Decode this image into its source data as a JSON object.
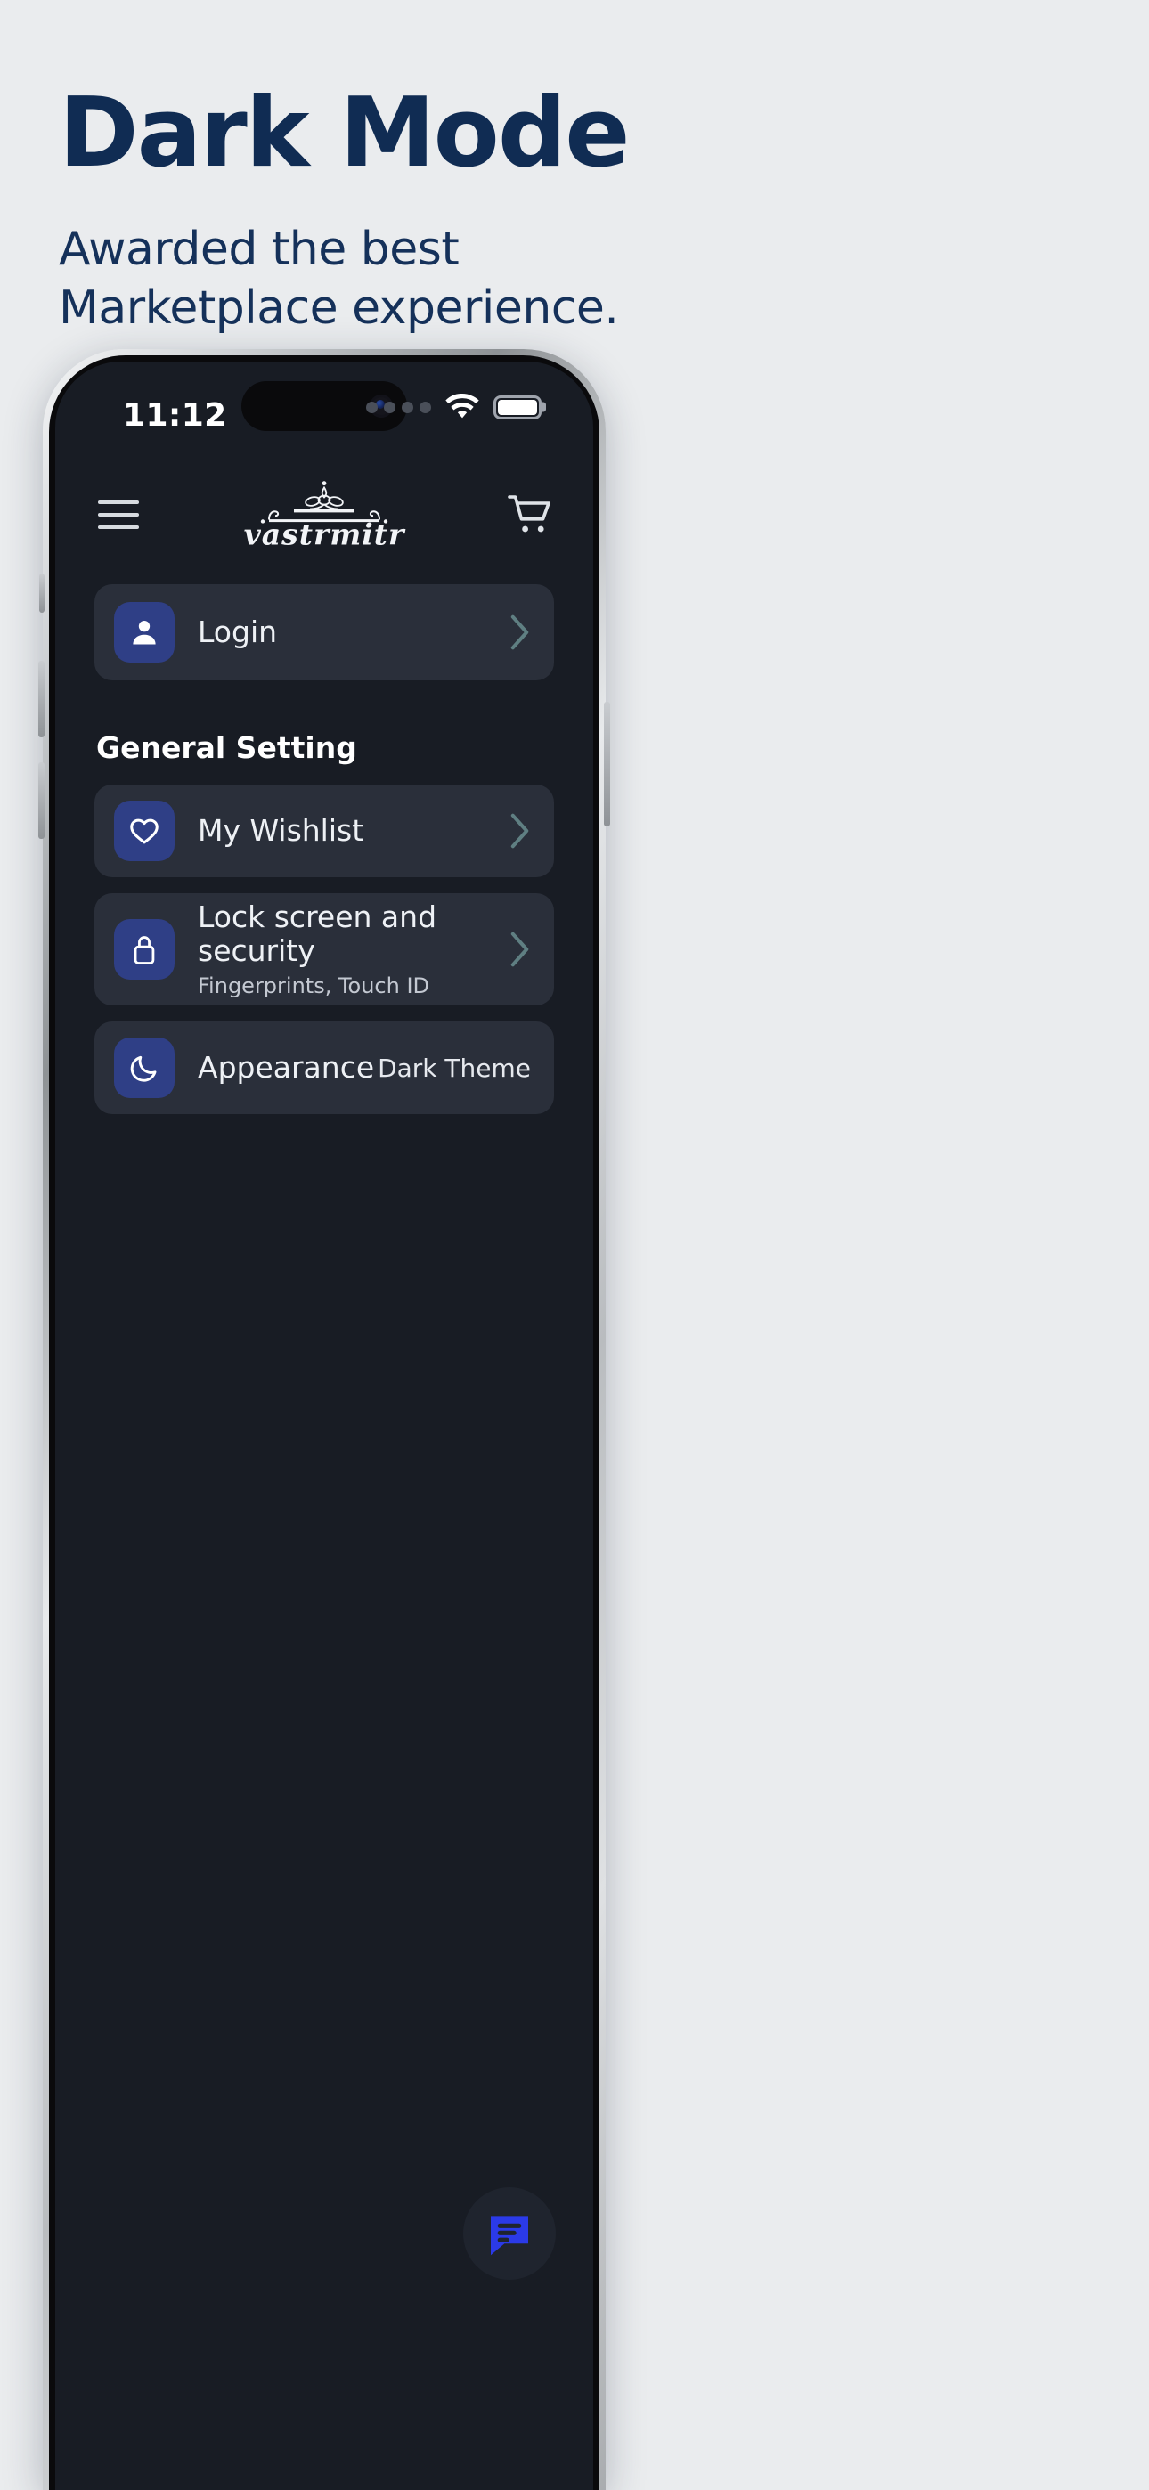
{
  "promo": {
    "title": "Dark Mode",
    "subtitle_line1": "Awarded the best",
    "subtitle_line2": "Marketplace experience.",
    "title_color": "#102c53",
    "background_color": "#eaecee"
  },
  "status_bar": {
    "time": "11:12",
    "signal_icon": "signal-dots-icon",
    "wifi_icon": "wifi-icon",
    "battery_icon": "battery-full-icon"
  },
  "app_header": {
    "menu_icon": "hamburger-menu-icon",
    "brand_name": "vastrmitr",
    "brand_ornament_icon": "trefoil-ornament-icon",
    "cart_icon": "shopping-cart-icon"
  },
  "login_card": {
    "label": "Login",
    "icon": "person-icon",
    "chevron": "chevron-right-icon"
  },
  "general_setting": {
    "heading": "General Setting",
    "items": [
      {
        "title": "My Wishlist",
        "subtitle": "",
        "value": "",
        "icon": "heart-icon",
        "chevron": "chevron-right-icon"
      },
      {
        "title": "Lock screen and security",
        "subtitle": "Fingerprints, Touch ID",
        "value": "",
        "icon": "lock-icon",
        "chevron": "chevron-right-icon"
      },
      {
        "title": "Appearance",
        "subtitle": "",
        "value": "Dark Theme",
        "icon": "moon-icon",
        "chevron": ""
      }
    ]
  },
  "fab": {
    "icon": "chat-bubble-icon",
    "accent_color": "#2b3ae8"
  },
  "theme": {
    "screen_bg": "#181c24",
    "card_bg": "#2a2f3a",
    "tile_bg": "#2f3f86",
    "text_primary": "#eef1f5",
    "text_secondary": "#c3c8d1",
    "chevron_color": "#5f7f82"
  }
}
